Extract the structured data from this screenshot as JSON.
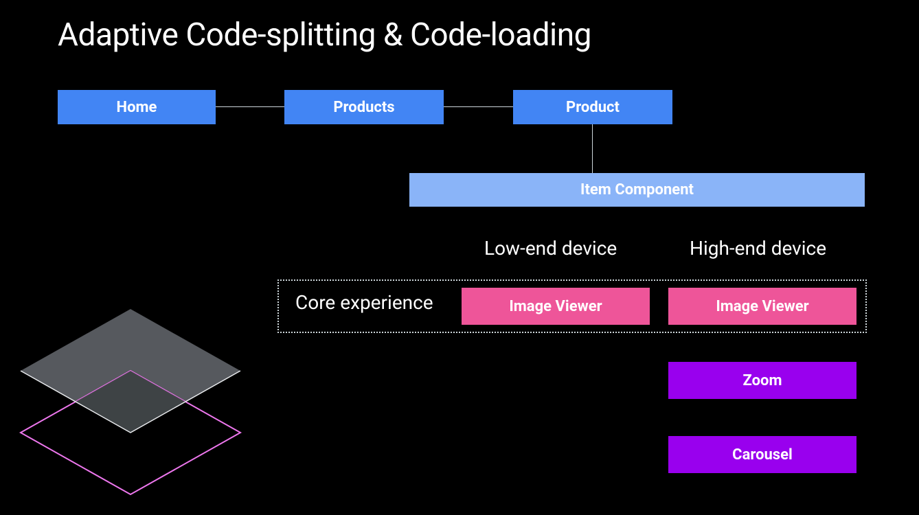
{
  "title": "Adaptive Code-splitting & Code-loading",
  "nodes": {
    "home": "Home",
    "products": "Products",
    "product": "Product"
  },
  "item_component": "Item Component",
  "columns": {
    "low": "Low-end device",
    "high": "High-end device"
  },
  "core_experience_label": "Core experience",
  "features": {
    "image_viewer": "Image Viewer",
    "zoom": "Zoom",
    "carousel": "Carousel"
  },
  "colors": {
    "blue": "#4285f4",
    "lightblue": "#8ab4f8",
    "pink": "#ee5599",
    "purple": "#9900ee"
  }
}
